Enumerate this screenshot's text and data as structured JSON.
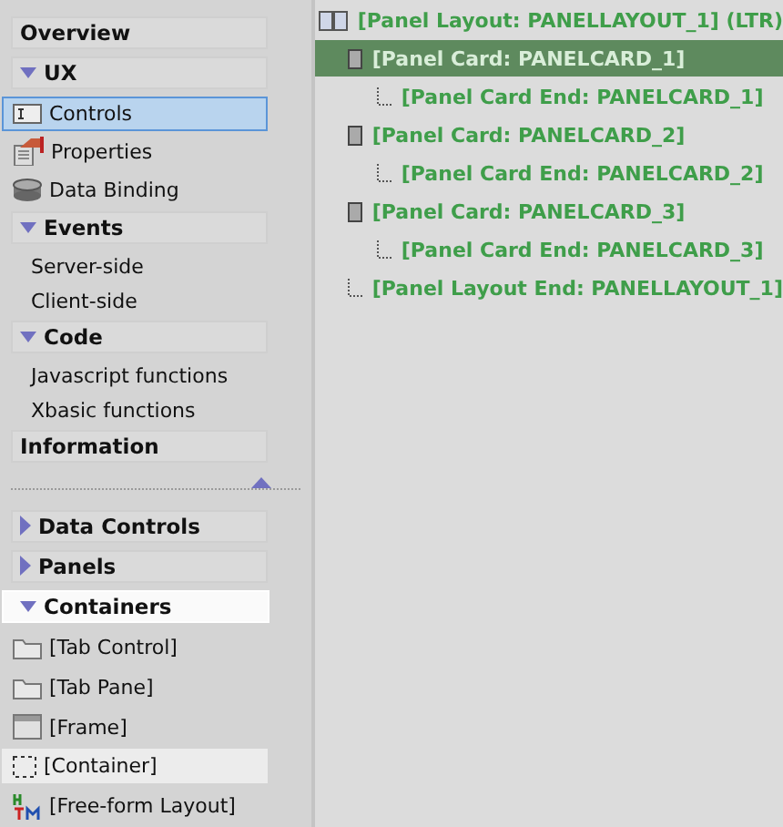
{
  "nav_top": [
    {
      "kind": "plain-header",
      "label": "Overview"
    },
    {
      "kind": "header",
      "label": "UX",
      "expanded": true
    },
    {
      "kind": "icon-item",
      "label": "Controls",
      "selected": true
    },
    {
      "kind": "icon-item",
      "label": "Properties",
      "selected": false
    },
    {
      "kind": "icon-item",
      "label": "Data Binding",
      "selected": false
    },
    {
      "kind": "header",
      "label": "Events",
      "expanded": true
    },
    {
      "kind": "text-item",
      "label": "Server-side"
    },
    {
      "kind": "text-item",
      "label": "Client-side"
    },
    {
      "kind": "header",
      "label": "Code",
      "expanded": true
    },
    {
      "kind": "text-item",
      "label": "Javascript functions"
    },
    {
      "kind": "text-item",
      "label": "Xbasic functions"
    },
    {
      "kind": "plain-header",
      "label": "Information"
    }
  ],
  "nav_bottom": [
    {
      "kind": "header",
      "label": "Data Controls",
      "expanded": false,
      "selected": false
    },
    {
      "kind": "header",
      "label": "Panels",
      "expanded": false,
      "selected": false
    },
    {
      "kind": "header",
      "label": "Containers",
      "expanded": true,
      "selected": true
    },
    {
      "kind": "icon-item",
      "label": "[Tab Control]",
      "selected": false
    },
    {
      "kind": "icon-item",
      "label": "[Tab Pane]",
      "selected": false
    },
    {
      "kind": "icon-item",
      "label": "[Frame]",
      "selected": false
    },
    {
      "kind": "icon-item",
      "label": "[Container]",
      "selected": true
    },
    {
      "kind": "icon-item",
      "label": "[Free-form Layout]",
      "selected": false
    }
  ],
  "tree": [
    {
      "label": "[Panel Layout: PANELLAYOUT_1] (LTR)",
      "kind": "layout",
      "selected": false,
      "children": [
        {
          "label": "[Panel Card: PANELCARD_1]",
          "kind": "card",
          "selected": true,
          "children": [
            {
              "label": "[Panel Card End: PANELCARD_1]",
              "kind": "end",
              "selected": false
            }
          ]
        },
        {
          "label": "[Panel Card: PANELCARD_2]",
          "kind": "card",
          "selected": false,
          "children": [
            {
              "label": "[Panel Card End: PANELCARD_2]",
              "kind": "end",
              "selected": false
            }
          ]
        },
        {
          "label": "[Panel Card: PANELCARD_3]",
          "kind": "card",
          "selected": false,
          "children": [
            {
              "label": "[Panel Card End: PANELCARD_3]",
              "kind": "end",
              "selected": false
            }
          ]
        },
        {
          "label": "[Panel Layout End: PANELLAYOUT_1]",
          "kind": "end",
          "selected": false
        }
      ]
    }
  ]
}
